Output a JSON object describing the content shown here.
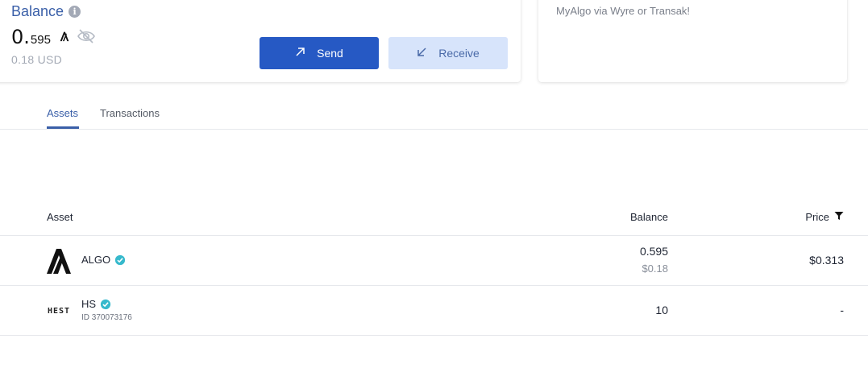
{
  "balance": {
    "title": "Balance",
    "info_glyph": "i",
    "amount_int": "0.",
    "amount_dec": "595",
    "usd": "0.18 USD",
    "send_label": "Send",
    "receive_label": "Receive"
  },
  "info_card": {
    "text": "MyAlgo via Wyre or Transak!"
  },
  "tabs": [
    {
      "label": "Assets",
      "active": true
    },
    {
      "label": "Transactions",
      "active": false
    }
  ],
  "table": {
    "headers": {
      "asset": "Asset",
      "balance": "Balance",
      "price": "Price"
    },
    "rows": [
      {
        "name": "ALGO",
        "balance": "0.595",
        "balance_usd": "$0.18",
        "price": "$0.313",
        "icon": "algorand-logo-icon"
      },
      {
        "name": "HS",
        "id": "ID 370073176",
        "balance": "10",
        "price": "-",
        "logo_text": "HEST",
        "icon": "hest-logo-icon"
      }
    ]
  },
  "colors": {
    "accent": "#2659c4",
    "title": "#3a5fa8",
    "verified": "#36b9cc"
  }
}
